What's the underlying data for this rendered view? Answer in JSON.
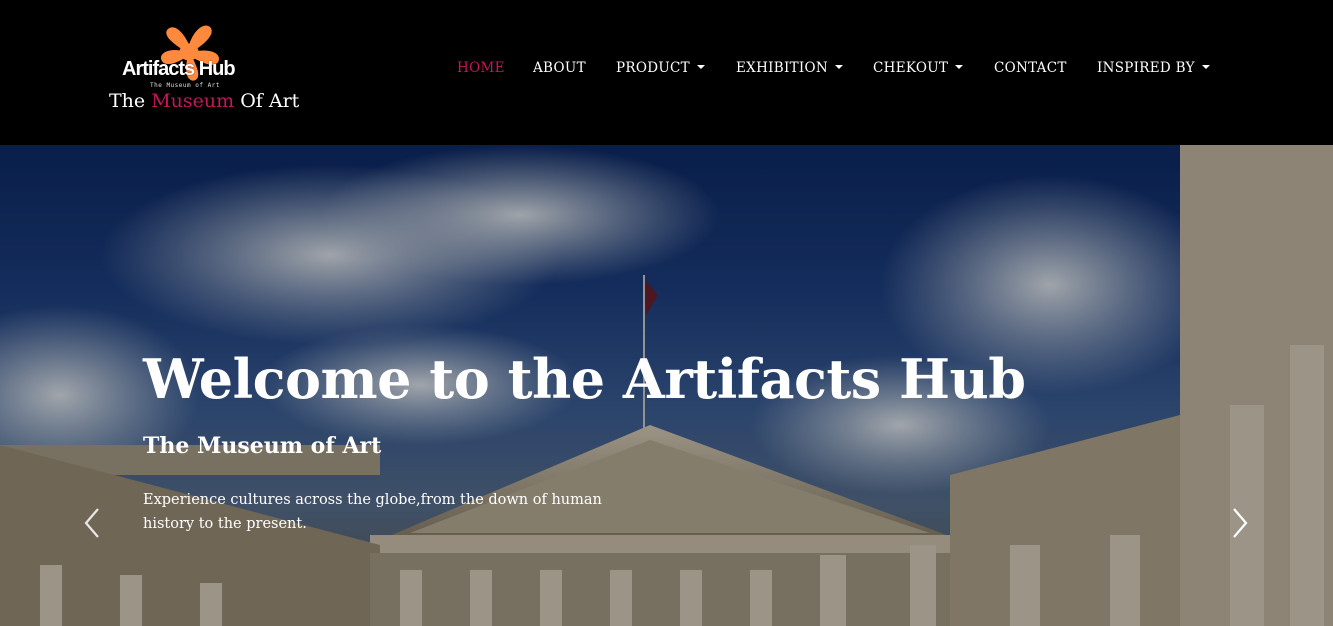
{
  "brand": {
    "logo_text": "Artifacts Hub",
    "logo_subtext": "The Museum of Art",
    "tagline_prefix": "The ",
    "tagline_accent": "Museum",
    "tagline_suffix": " Of Art",
    "logo_icon": "orange-flower-icon",
    "accent_color": "#c2185b",
    "logo_color": "#ff8a3d"
  },
  "nav": {
    "items": [
      {
        "label": "HOME",
        "active": true,
        "dropdown": false
      },
      {
        "label": "ABOUT",
        "active": false,
        "dropdown": false
      },
      {
        "label": "PRODUCT",
        "active": false,
        "dropdown": true
      },
      {
        "label": "EXHIBITION",
        "active": false,
        "dropdown": true
      },
      {
        "label": "CHEKOUT",
        "active": false,
        "dropdown": true
      },
      {
        "label": "CONTACT",
        "active": false,
        "dropdown": false
      },
      {
        "label": "INSPIRED BY",
        "active": false,
        "dropdown": true
      }
    ]
  },
  "hero": {
    "title": "Welcome to the Artifacts Hub",
    "subtitle": "The Museum of Art",
    "description": "Experience cultures across the globe,from the down of human history to the present.",
    "prev_icon": "chevron-left-icon",
    "next_icon": "chevron-right-icon"
  }
}
